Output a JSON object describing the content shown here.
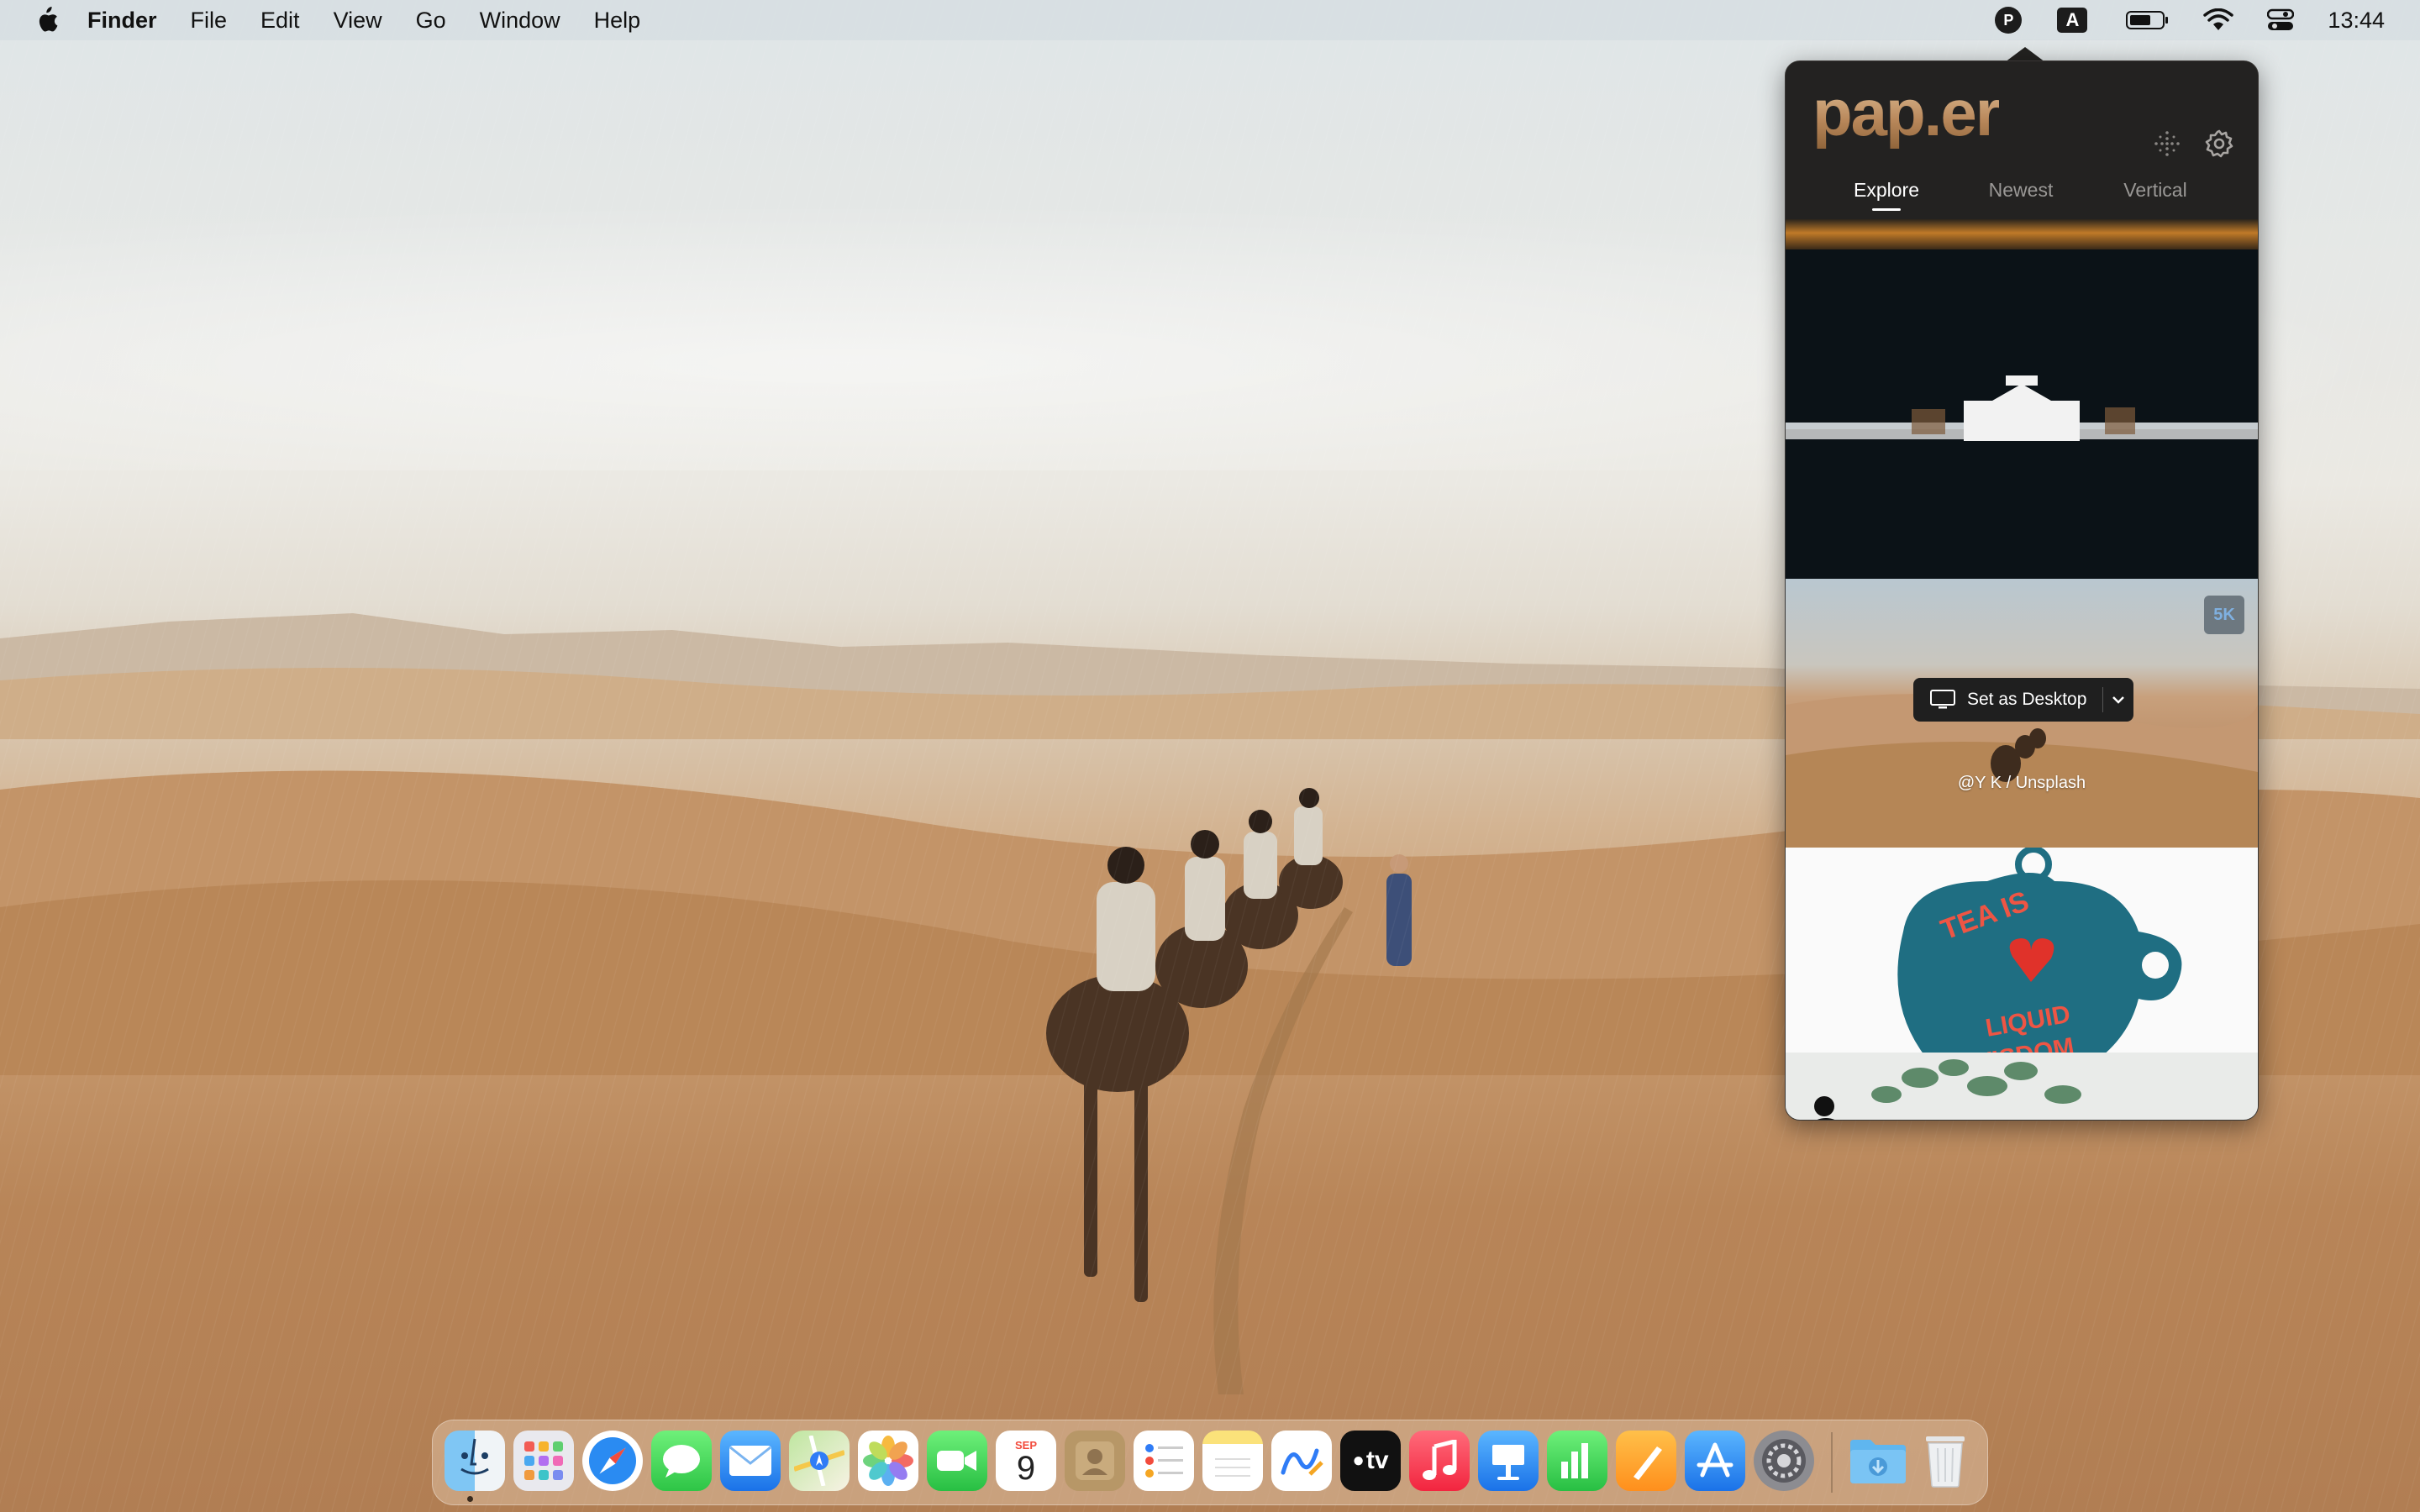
{
  "menubar": {
    "app_name": "Finder",
    "menus": [
      "File",
      "Edit",
      "View",
      "Go",
      "Window",
      "Help"
    ],
    "status": {
      "paper_icon_letter": "P",
      "input_source_letter": "A",
      "clock": "13:44"
    }
  },
  "paper_app": {
    "logo": "pap.er",
    "tabs": [
      {
        "label": "Explore",
        "active": true
      },
      {
        "label": "Newest",
        "active": false
      },
      {
        "label": "Vertical",
        "active": false
      }
    ],
    "wallpaper_cards": [
      {
        "description": "sunset over water (partial)"
      },
      {
        "description": "white building lit at night"
      },
      {
        "badge": "5K",
        "set_desktop_label": "Set as Desktop",
        "credit": "@Y K / Unsplash"
      },
      {
        "description": "teapot ornament: TEA IS LIQUID WISDOM",
        "ornament_text": [
          "TEA IS",
          "LIQUID",
          "WISDOM"
        ]
      },
      {
        "description": "eucalyptus leaves (partial)"
      }
    ]
  },
  "dock": {
    "apps": [
      "Finder",
      "Launchpad",
      "Safari",
      "Messages",
      "Mail",
      "Maps",
      "Photos",
      "FaceTime",
      "Calendar",
      "Contacts",
      "Reminders",
      "Notes",
      "Freeform",
      "TV",
      "Music",
      "Keynote",
      "Numbers",
      "Pages",
      "App Store",
      "System Settings"
    ],
    "calendar_month": "SEP",
    "calendar_day": "9",
    "tv_label": "tv",
    "trailing": [
      "Downloads",
      "Trash"
    ]
  },
  "colors": {
    "accent_gold": "#c9a57a",
    "popover_bg": "#1f1e1d"
  }
}
